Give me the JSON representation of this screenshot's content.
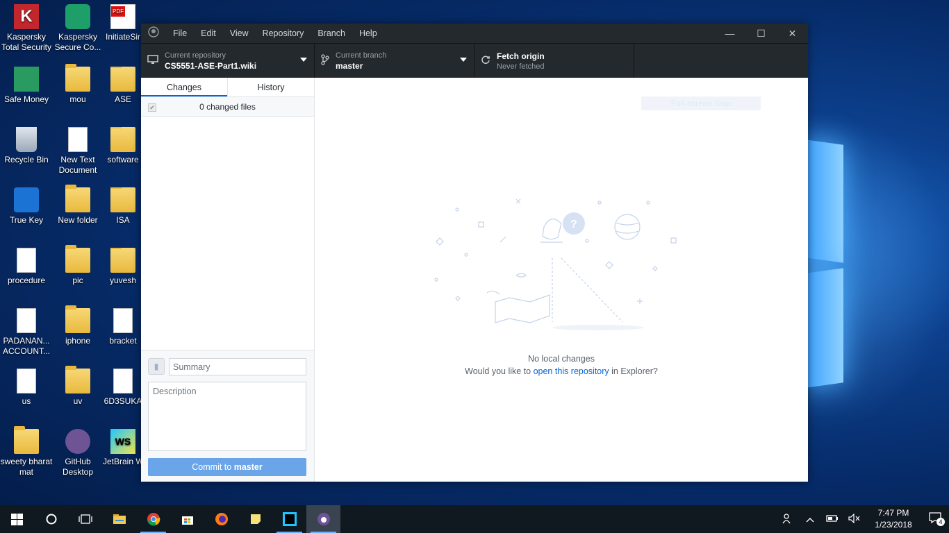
{
  "desktop": {
    "icons": [
      {
        "label": "Kaspersky Total Security"
      },
      {
        "label": "Kaspersky Secure Co..."
      },
      {
        "label": "InitiateSir"
      },
      {
        "label": "Safe Money"
      },
      {
        "label": "mou"
      },
      {
        "label": "ASE"
      },
      {
        "label": "Recycle Bin"
      },
      {
        "label": "New Text Document"
      },
      {
        "label": "software"
      },
      {
        "label": "True Key"
      },
      {
        "label": "New folder"
      },
      {
        "label": "ISA"
      },
      {
        "label": "procedure"
      },
      {
        "label": "pic"
      },
      {
        "label": "yuvesh"
      },
      {
        "label": "PADANAN... ACCOUNT..."
      },
      {
        "label": "iphone"
      },
      {
        "label": "bracket"
      },
      {
        "label": "us"
      },
      {
        "label": "uv"
      },
      {
        "label": "6D3SUKA"
      },
      {
        "label": "sweety bharat mat"
      },
      {
        "label": "GitHub Desktop"
      },
      {
        "label": "JetBrain WebStor"
      }
    ]
  },
  "window": {
    "menu": [
      "File",
      "Edit",
      "View",
      "Repository",
      "Branch",
      "Help"
    ],
    "controls": {
      "minimize": "—",
      "maximize": "☐",
      "close": "✕"
    }
  },
  "toolbar": {
    "repo": {
      "caption": "Current repository",
      "value": "CS5551-ASE-Part1.wiki"
    },
    "branch": {
      "caption": "Current branch",
      "value": "master"
    },
    "fetch": {
      "caption": "Fetch origin",
      "value": "Never fetched"
    }
  },
  "sidebar": {
    "tabs": [
      "Changes",
      "History"
    ],
    "changed_files": "0 changed files",
    "summary_placeholder": "Summary",
    "description_placeholder": "Description",
    "commit_prefix": "Commit to ",
    "commit_branch": "master"
  },
  "main": {
    "snip_label": "Full-screen Snip",
    "no_changes": "No local changes",
    "prompt_before": "Would you like to ",
    "prompt_link": "open this repository",
    "prompt_after": " in Explorer?"
  },
  "taskbar": {
    "time": "7:47 PM",
    "date": "1/23/2018",
    "notifications": "4"
  }
}
